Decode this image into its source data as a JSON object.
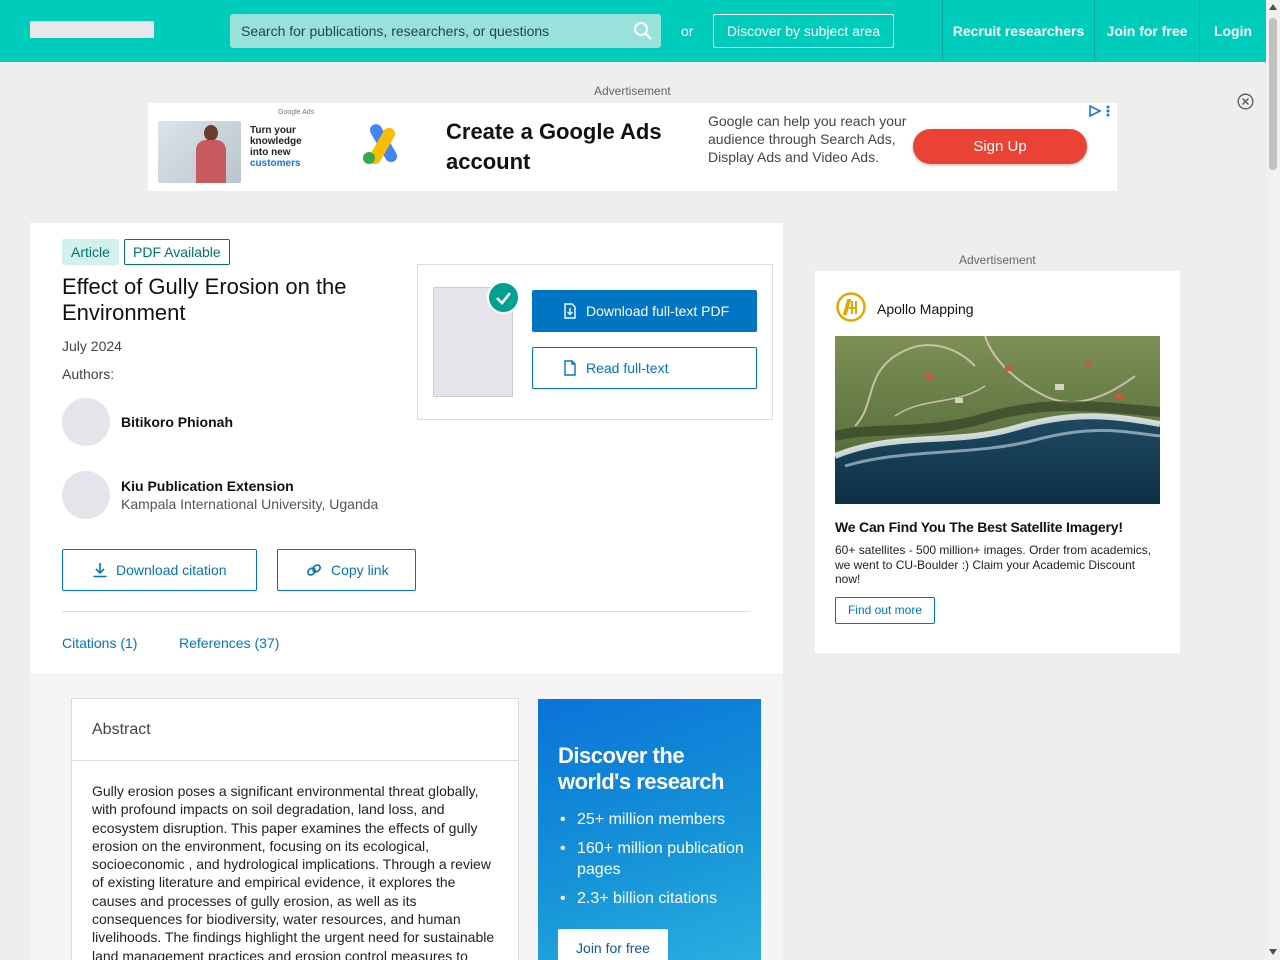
{
  "header": {
    "search_placeholder": "Search for publications, researchers, or questions",
    "or_text": "or",
    "discover_label": "Discover by subject area",
    "nav": {
      "recruit": "Recruit researchers",
      "join": "Join for free",
      "login": "Login"
    },
    "brand_color": "#00ccbb"
  },
  "top_ad": {
    "label": "Advertisement",
    "thumb_small": "Google Ads",
    "thumb_text_1": "Turn your knowledge into new ",
    "thumb_text_2": "customers",
    "headline": "Create a Google Ads account",
    "body": "Google can help you reach your audience through Search Ads, Display Ads and Video Ads.",
    "cta": "Sign Up",
    "cta_color": "#ea4335"
  },
  "article": {
    "badges": [
      "Article",
      "PDF Available"
    ],
    "title": "Effect of Gully Erosion on the Environment",
    "date": "July 2024",
    "authors_label": "Authors:",
    "authors": [
      {
        "name": "Bitikoro Phionah",
        "affiliation": ""
      },
      {
        "name": "Kiu Publication Extension",
        "affiliation": "Kampala International University, Uganda"
      }
    ],
    "download_citation": "Download citation",
    "copy_link": "Copy link",
    "tabs": [
      "Citations (1)",
      "References (37)"
    ]
  },
  "pdf_box": {
    "download_pdf": "Download full-text PDF",
    "read_fulltext": "Read full-text",
    "accent": "#0075c4"
  },
  "abstract": {
    "heading": "Abstract",
    "text": "Gully erosion poses a significant environmental threat globally, with profound impacts on soil degradation, land loss, and ecosystem disruption. This paper examines the effects of gully erosion on the environment, focusing on its ecological, socioeconomic , and hydrological implications. Through a review of existing literature and empirical evidence, it explores the causes and processes of gully erosion, as well as its consequences for biodiversity, water resources, and human livelihoods. The findings highlight the urgent need for sustainable land management practices and erosion control measures to"
  },
  "discover_panel": {
    "heading": "Discover the world's research",
    "stats": [
      "25+ million members",
      "160+ million publication pages",
      "2.3+ billion citations"
    ],
    "cta": "Join for free"
  },
  "side_ad": {
    "label": "Advertisement",
    "advertiser": "Apollo Mapping",
    "headline": "We Can Find You The Best Satellite Imagery!",
    "body": "60+ satellites - 500 million+ images. Order from academics, we went to CU-Boulder :) Claim your Academic Discount now!",
    "cta": "Find out more"
  },
  "icons": [
    "search-icon",
    "adchoices-icon",
    "close-icon",
    "check-icon",
    "download-icon",
    "document-icon",
    "link-icon"
  ]
}
